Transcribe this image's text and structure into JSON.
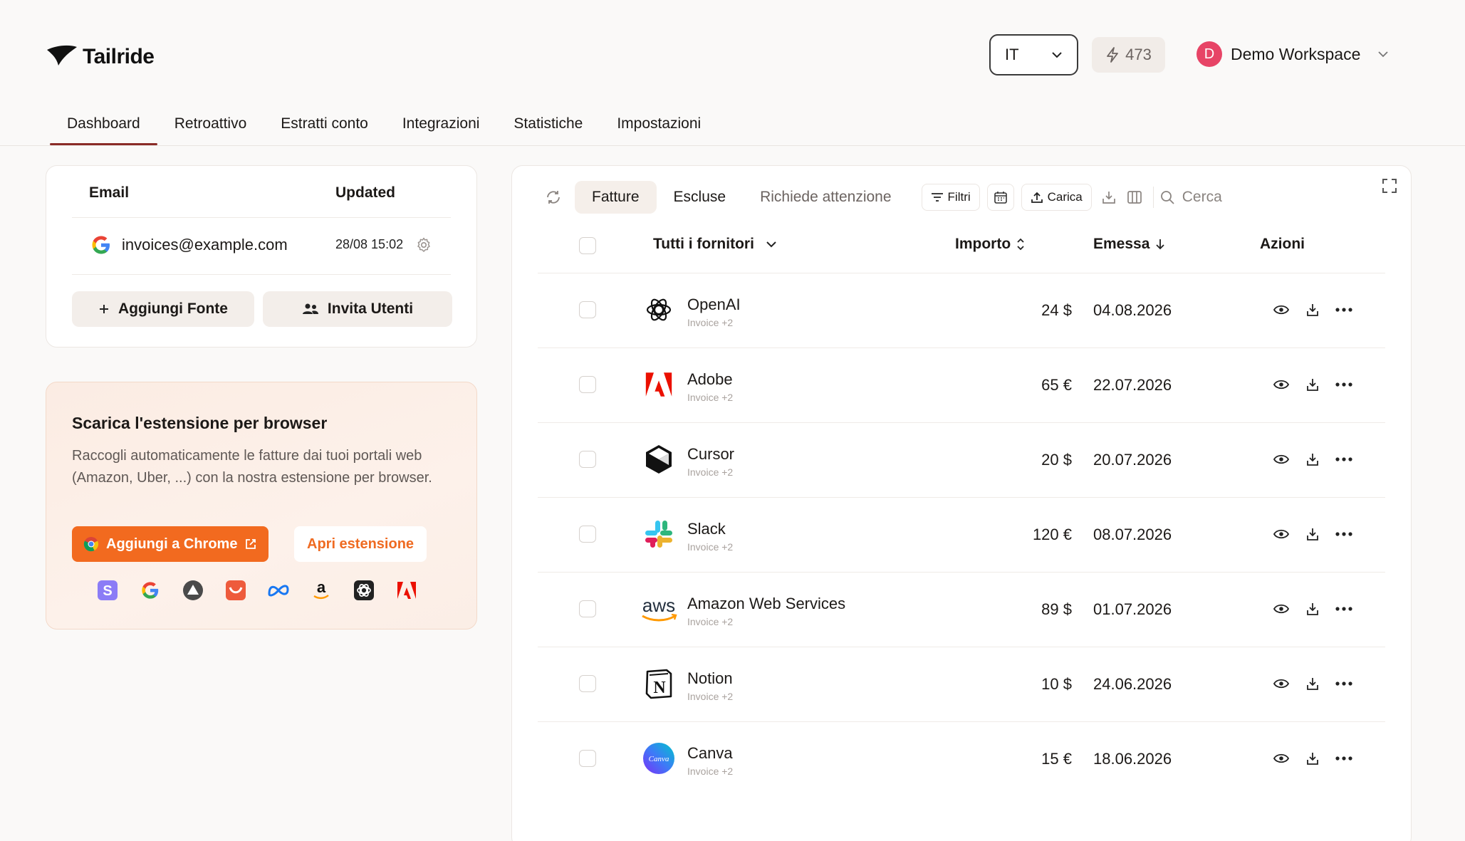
{
  "app": {
    "name": "Tailride"
  },
  "header": {
    "language": "IT",
    "credits": "473",
    "workspace_initial": "D",
    "workspace_name": "Demo Workspace"
  },
  "nav_tabs": [
    {
      "label": "Dashboard",
      "active": true
    },
    {
      "label": "Retroattivo"
    },
    {
      "label": "Estratti conto"
    },
    {
      "label": "Integrazioni"
    },
    {
      "label": "Statistiche"
    },
    {
      "label": "Impostazioni"
    }
  ],
  "sources": {
    "col_email": "Email",
    "col_updated": "Updated",
    "email": "invoices@example.com",
    "updated": "28/08 15:02",
    "add_source": "Aggiungi Fonte",
    "invite_users": "Invita Utenti"
  },
  "extension": {
    "title": "Scarica l'estensione per browser",
    "description": "Raccogli automaticamente le fatture dai tuoi portali web (Amazon, Uber, ...) con la nostra estensione per browser.",
    "add_chrome": "Aggiungi a Chrome",
    "open_extension": "Apri estensione",
    "icons": [
      "stripe-icon",
      "google-icon",
      "vercel-icon",
      "todoist-icon",
      "meta-icon",
      "amazon-icon",
      "openai-icon",
      "adobe-icon"
    ]
  },
  "toolbar": {
    "segments": [
      "Fatture",
      "Escluse",
      "Richiede attenzione"
    ],
    "filters": "Filtri",
    "upload": "Carica",
    "search_placeholder": "Cerca"
  },
  "table": {
    "headers": {
      "vendor": "Tutti i fornitori",
      "amount": "Importo",
      "issued": "Emessa",
      "actions": "Azioni"
    },
    "rows": [
      {
        "vendor": "OpenAI",
        "sub": "Invoice +2",
        "amount": "24 $",
        "date": "04.08.2026",
        "logo": "openai-logo"
      },
      {
        "vendor": "Adobe",
        "sub": "Invoice +2",
        "amount": "65 €",
        "date": "22.07.2026",
        "logo": "adobe-logo"
      },
      {
        "vendor": "Cursor",
        "sub": "Invoice +2",
        "amount": "20 $",
        "date": "20.07.2026",
        "logo": "cursor-logo"
      },
      {
        "vendor": "Slack",
        "sub": "Invoice +2",
        "amount": "120 €",
        "date": "08.07.2026",
        "logo": "slack-logo"
      },
      {
        "vendor": "Amazon Web Services",
        "sub": "Invoice +2",
        "amount": "89 $",
        "date": "01.07.2026",
        "logo": "aws-logo"
      },
      {
        "vendor": "Notion",
        "sub": "Invoice +2",
        "amount": "10 $",
        "date": "24.06.2026",
        "logo": "notion-logo"
      },
      {
        "vendor": "Canva",
        "sub": "Invoice +2",
        "amount": "15 €",
        "date": "18.06.2026",
        "logo": "canva-logo",
        "logo_text": "Canva"
      }
    ]
  },
  "colors": {
    "accent": "#8a2b27",
    "chrome_button": "#f26a1f",
    "workspace_avatar": "#e74466"
  }
}
